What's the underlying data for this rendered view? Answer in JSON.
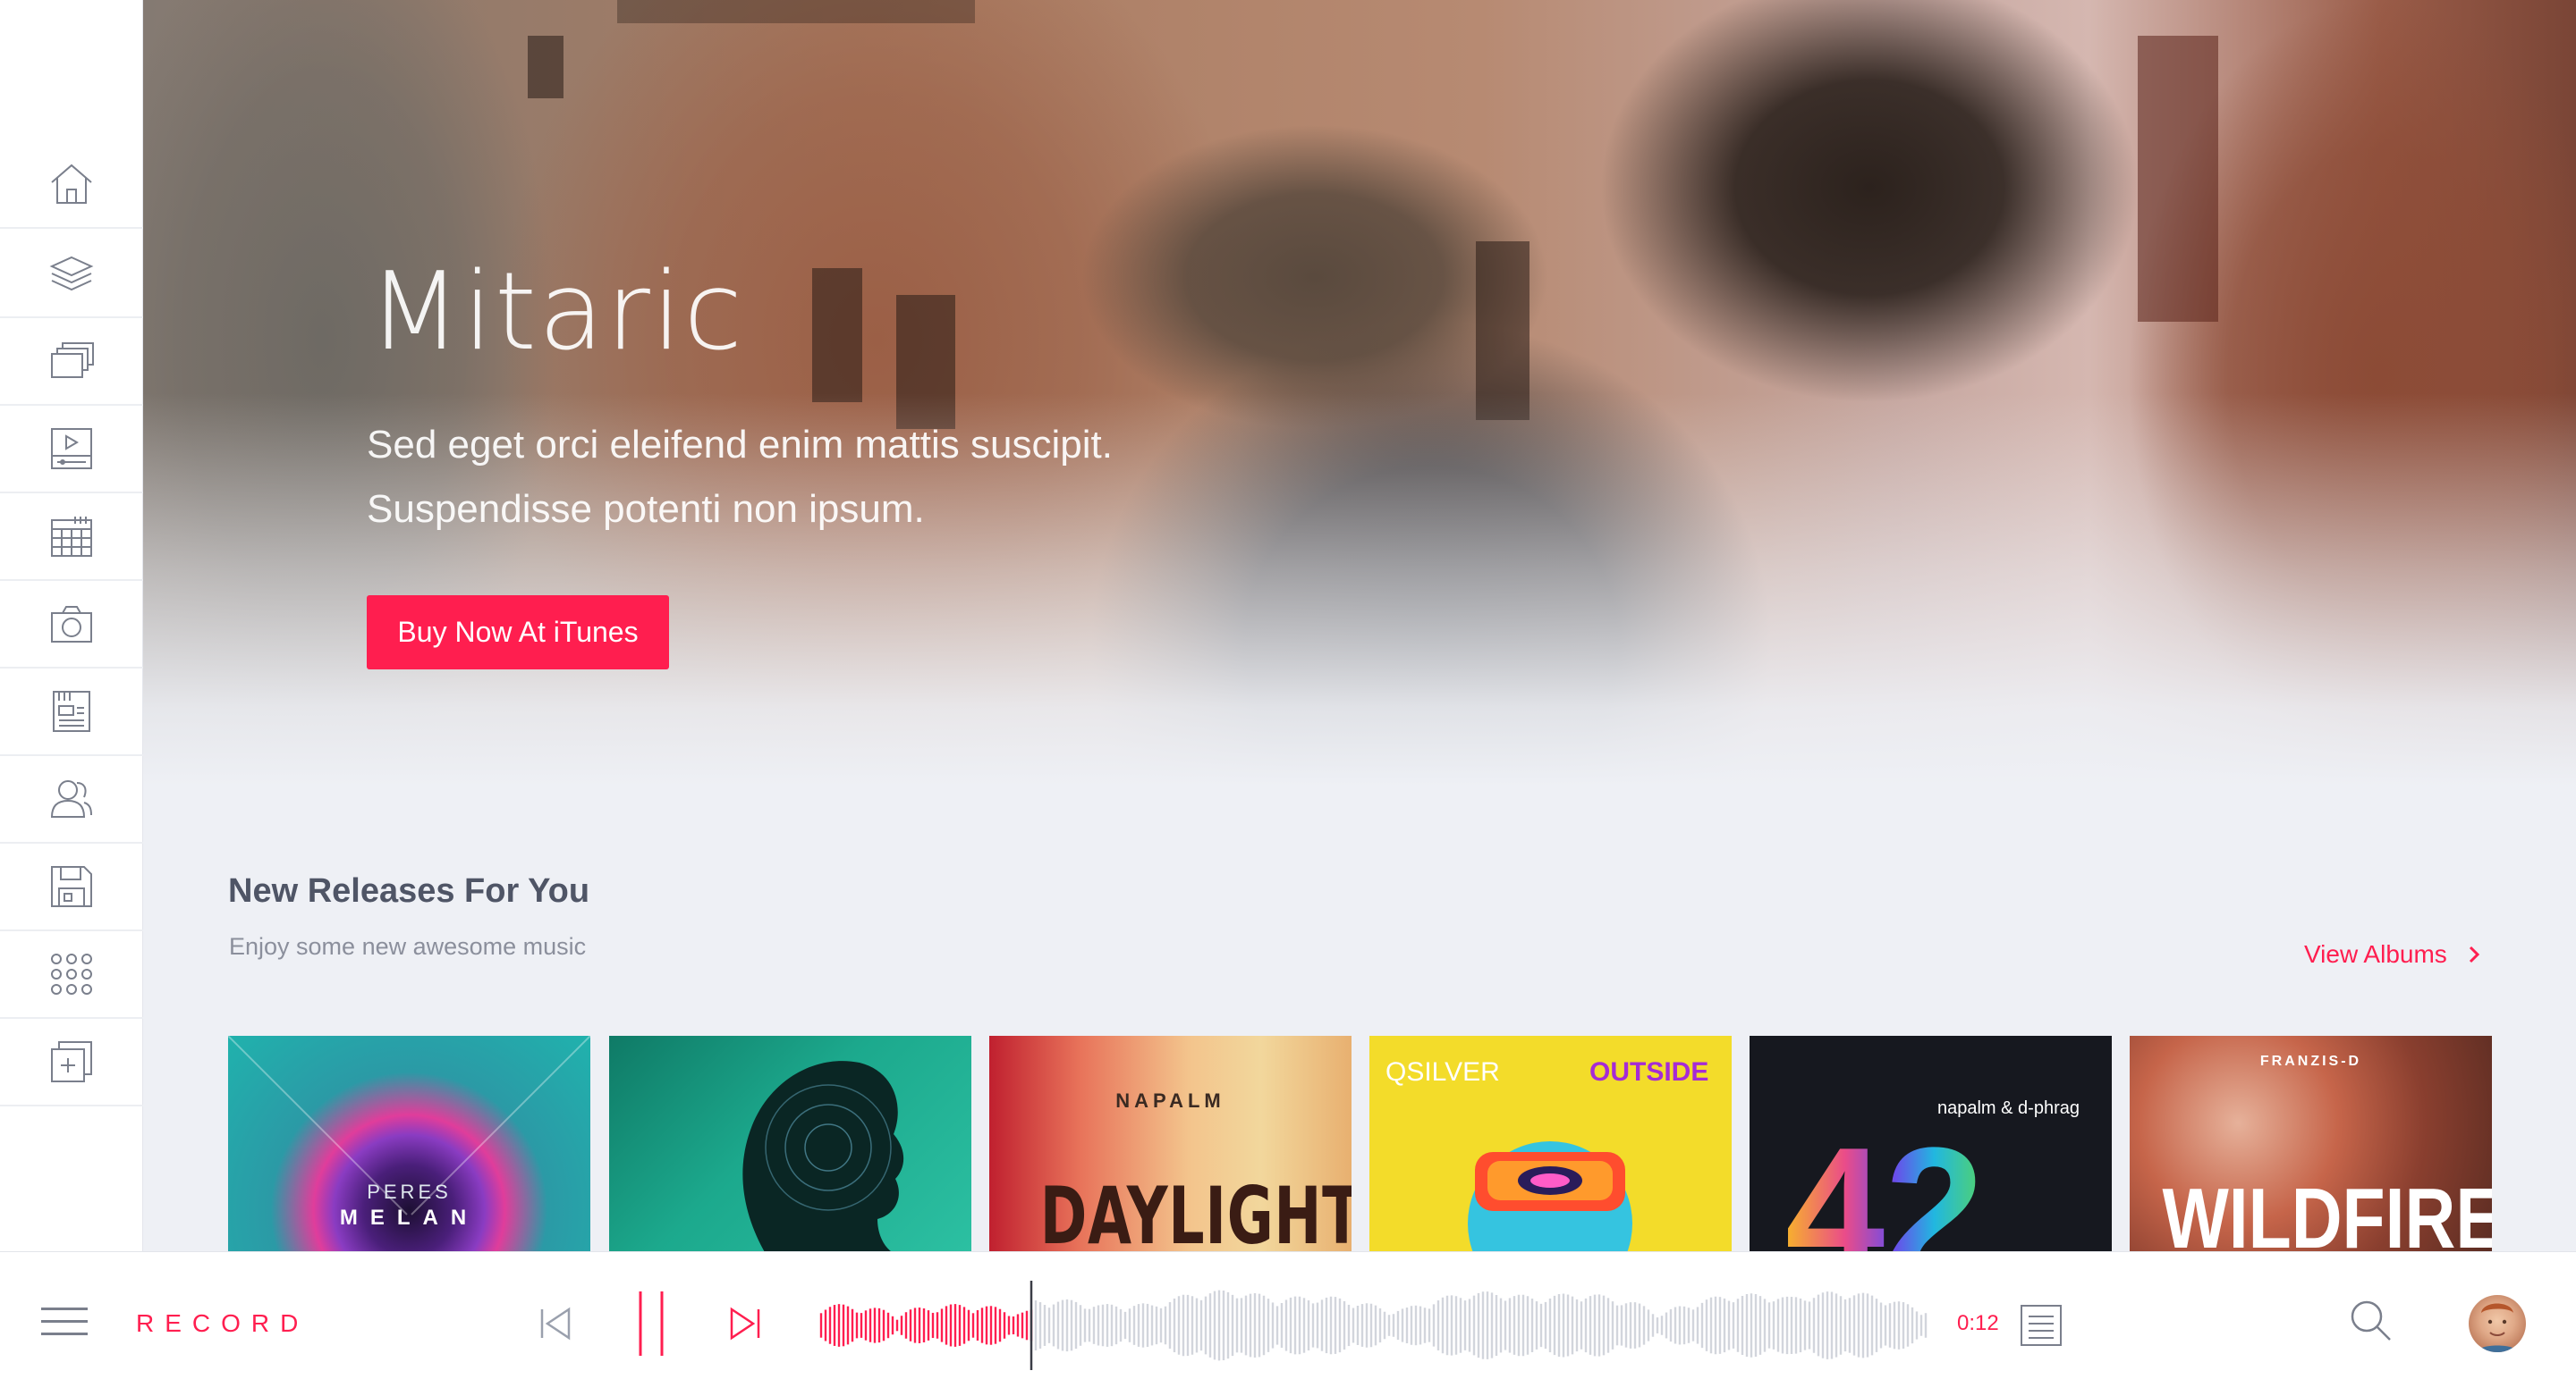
{
  "sidebar": {
    "items": [
      {
        "name": "home",
        "icon": "home-icon"
      },
      {
        "name": "layers",
        "icon": "layers-icon"
      },
      {
        "name": "gallery",
        "icon": "gallery-icon"
      },
      {
        "name": "video",
        "icon": "video-player-icon"
      },
      {
        "name": "calendar",
        "icon": "calendar-icon"
      },
      {
        "name": "camera",
        "icon": "camera-icon"
      },
      {
        "name": "news",
        "icon": "newspaper-icon"
      },
      {
        "name": "users",
        "icon": "users-icon"
      },
      {
        "name": "save",
        "icon": "floppy-disk-icon"
      },
      {
        "name": "apps",
        "icon": "grid-icon"
      },
      {
        "name": "add",
        "icon": "add-window-icon"
      }
    ]
  },
  "hero": {
    "title": "Mitaric",
    "subtitle_line1": "Sed eget orci eleifend enim mattis suscipit.",
    "subtitle_line2": "Suspendisse potenti non ipsum.",
    "cta_label": "Buy Now At iTunes"
  },
  "releases": {
    "title": "New Releases For You",
    "subtitle": "Enjoy some new awesome music",
    "view_all_label": "View Albums",
    "albums": [
      {
        "artist": "PERES",
        "title": "MELAN"
      },
      {
        "artist": "",
        "title": ""
      },
      {
        "artist": "NAPALM",
        "title": "DAYLIGHT"
      },
      {
        "artist": "QSILVER",
        "title": "OUTSIDE"
      },
      {
        "artist": "napalm & d-phrag",
        "title": "42"
      },
      {
        "artist": "FRANZIS-D",
        "title": "WILDFIRE"
      }
    ]
  },
  "player": {
    "menu_icon": "hamburger-menu-icon",
    "record_label": "RECORD",
    "time": "0:12",
    "progress": 0.19,
    "icons": {
      "prev": "skip-back-icon",
      "pause": "pause-icon",
      "next": "skip-forward-icon",
      "playlist": "playlist-icon",
      "search": "search-icon",
      "avatar": "user-avatar"
    }
  },
  "colors": {
    "accent": "#ff1e4f",
    "background": "#eef0f5",
    "sidebar_icon": "#7a7f8c",
    "waveform_inactive": "#d2d5dc"
  }
}
